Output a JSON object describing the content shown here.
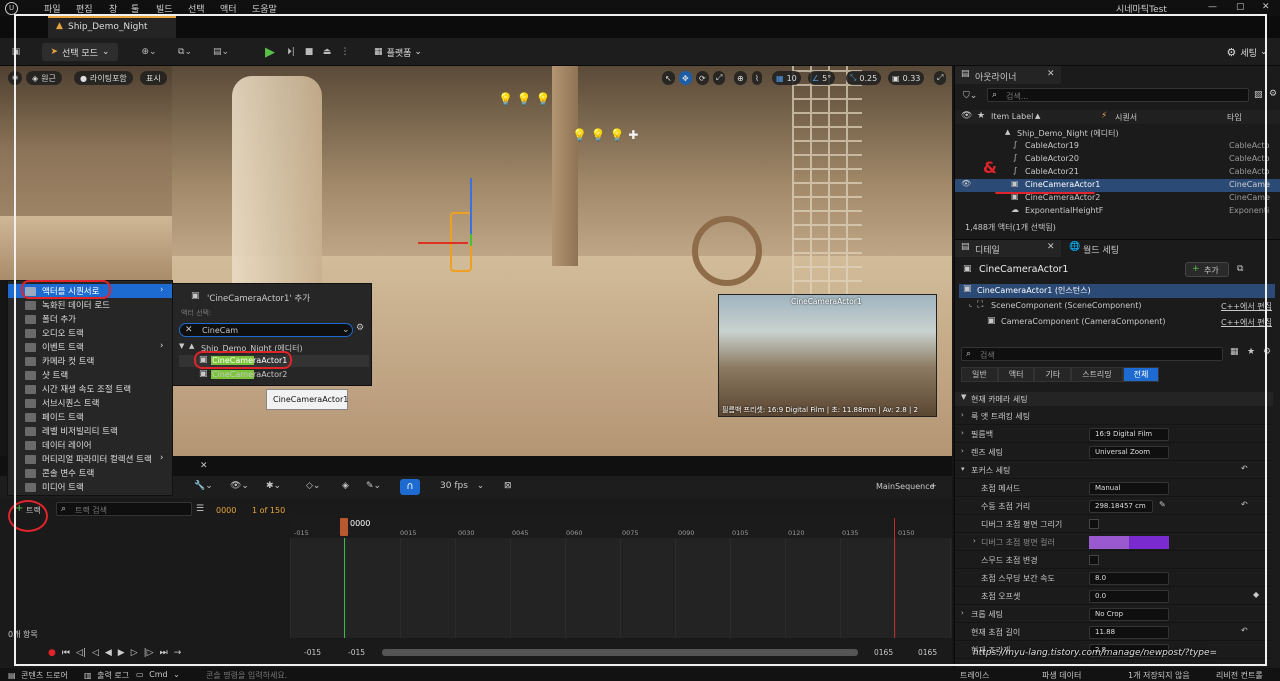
{
  "menu": {
    "items": [
      "파일",
      "편집",
      "창",
      "툴",
      "빌드",
      "선택",
      "액터",
      "도움말"
    ],
    "project": "시네마틱Test"
  },
  "tab": {
    "label": "Ship_Demo_Night"
  },
  "toolbar": {
    "mode": "선택 모드",
    "platform": "플랫폼",
    "settings": "세팅"
  },
  "viewport": {
    "perspective": "원근",
    "lighting": "라이팅포함",
    "show": "표시",
    "grid": "10",
    "angle": "5°",
    "scale": "0.25",
    "camspeed": "0.33",
    "pip_title": "CineCameraActor1",
    "pip_caption": "필름백 프리셋: 16:9 Digital Film | 초: 11.88mm | Av: 2.8 | 2"
  },
  "outliner": {
    "title": "아웃라이너",
    "search_placeholder": "검색...",
    "col_label": "Item Label",
    "col_seq": "시퀀서",
    "col_type": "타입",
    "rows": [
      {
        "label": "Ship_Demo_Night (에디터)",
        "type": ""
      },
      {
        "label": "CableActor19",
        "type": "CableActo"
      },
      {
        "label": "CableActor20",
        "type": "CableActo"
      },
      {
        "label": "CableActor21",
        "type": "CableActo"
      },
      {
        "label": "CineCameraActor1",
        "type": "CineCame"
      },
      {
        "label": "CineCameraActor2",
        "type": "CineCame"
      },
      {
        "label": "ExponentialHeightF",
        "type": "Exponenti"
      }
    ],
    "footer": "1,488개 액터(1개 선택됨)"
  },
  "details": {
    "tab": "디테일",
    "world_tab": "월드 세팅",
    "actor": "CineCameraActor1",
    "add": "추가",
    "instance": "CineCameraActor1 (인스턴스)",
    "comp_scene": "SceneComponent (SceneComponent)",
    "comp_camera": "CameraComponent (CameraComponent)",
    "edit_cpp": "C++에서 편집",
    "search_placeholder": "검색",
    "filters": [
      "일반",
      "액터",
      "기타",
      "스트리밍",
      "전체"
    ],
    "section_current": "현재 카메라 세팅",
    "rows": [
      {
        "label": "룩 앳 트래킹 세팅",
        "value": ""
      },
      {
        "label": "필름백",
        "value": "16:9 Digital Film"
      },
      {
        "label": "렌즈 세팅",
        "value": "Universal Zoom"
      },
      {
        "label": "포커스 세팅",
        "value": ""
      },
      {
        "label": "초점 메서드",
        "value": "Manual"
      },
      {
        "label": "수동 초점 거리",
        "value": "298.18457 cm"
      },
      {
        "label": "디버그 초점 평면 그리기",
        "value": ""
      },
      {
        "label": "디버그 초점 평면 컬러",
        "value": ""
      },
      {
        "label": "스무드 초점 변경",
        "value": ""
      },
      {
        "label": "초점 스무딩 보간 속도",
        "value": "8.0"
      },
      {
        "label": "초점 오프셋",
        "value": "0.0"
      },
      {
        "label": "크롭 세팅",
        "value": "No Crop"
      },
      {
        "label": "현재 초점 길이",
        "value": "11.88"
      },
      {
        "label": "현재 조리개",
        "value": "2.8"
      }
    ]
  },
  "context_menu": {
    "items": [
      "액터를 시퀀서로",
      "녹화된 데이터 로드",
      "폴더 추가",
      "오디오 트랙",
      "이벤트 트랙",
      "카메라 컷 트랙",
      "샷 트랙",
      "시간 재생 속도 조절 트랙",
      "서브시퀀스 트랙",
      "페이드 트랙",
      "레벨 비저빌리티 트랙",
      "데이터 레이어",
      "머티리얼 파라미터 컬렉션 트랙",
      "콘솔 변수 트랙",
      "미디어 트랙"
    ],
    "submenu_title": "'CineCameraActor1' 추가",
    "submenu_hint": "액터 선택:",
    "submenu_search": "CineCam",
    "submenu_group": "Ship_Demo_Night (에디터)",
    "submenu_items": [
      "CineCameraActor1",
      "CineCameraActor2"
    ],
    "tooltip": "CineCameraActor1"
  },
  "sequencer": {
    "fps": "30 fps",
    "seq_name": "MainSequence",
    "track_button": "트랙",
    "track_search": "트랙 검색",
    "frame_current": "0000",
    "frame_of": "1 of 150",
    "playhead": "0000",
    "ticks": [
      "-015",
      "0015",
      "0030",
      "0045",
      "0060",
      "0075",
      "0090",
      "0105",
      "0120",
      "0135",
      "0150"
    ],
    "items_count": "0개 항목",
    "range_start1": "-015",
    "range_start2": "-015",
    "range_end1": "0165",
    "range_end2": "0165"
  },
  "statusbar": {
    "content_drawer": "콘텐츠 드로어",
    "output_log": "출력 로그",
    "cmd": "Cmd",
    "console_placeholder": "콘솔 명령을 입력하세요.",
    "trace": "트레이스",
    "derived": "파생 데이터",
    "unsaved": "1개 저장되지 않음",
    "revision": "리비전 컨트롤"
  },
  "watermark": "https://myu-lang.tistory.com/manage/newpost/?type="
}
